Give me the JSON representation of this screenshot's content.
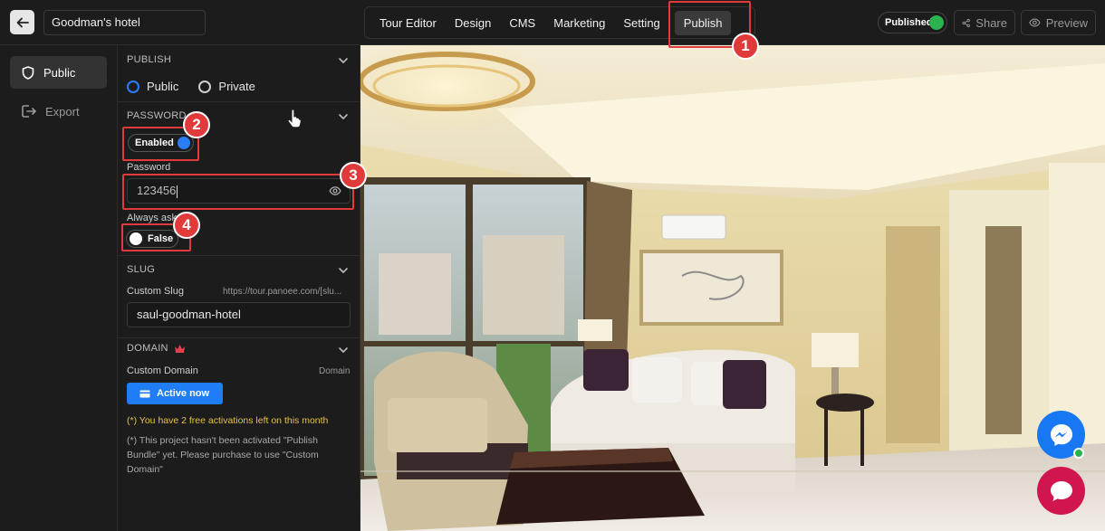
{
  "header": {
    "project_title": "Goodman's hotel",
    "nav": [
      {
        "label": "Tour Editor"
      },
      {
        "label": "Design"
      },
      {
        "label": "CMS"
      },
      {
        "label": "Marketing"
      },
      {
        "label": "Setting"
      },
      {
        "label": "Publish"
      }
    ],
    "active_nav": "Publish",
    "status_label": "Published",
    "status_color": "#2ab34f",
    "share_label": "Share",
    "preview_label": "Preview"
  },
  "rail": {
    "items": [
      {
        "label": "Public",
        "icon": "shield-icon"
      },
      {
        "label": "Export",
        "icon": "export-icon"
      }
    ],
    "active": "Public"
  },
  "panel": {
    "publish": {
      "heading": "PUBLISH",
      "options": [
        "Public",
        "Private"
      ],
      "selected": "Public"
    },
    "password": {
      "heading": "PASSWORD",
      "toggle_label": "Enabled",
      "toggle_on": true,
      "field_label": "Password",
      "field_value": "123456",
      "always_ask_label": "Always ask",
      "always_ask_toggle_label": "False",
      "always_ask_on": false
    },
    "slug": {
      "heading": "SLUG",
      "field_label": "Custom Slug",
      "url_hint": "https://tour.panoee.com/[slu...",
      "value": "saul-goodman-hotel"
    },
    "domain": {
      "heading": "DOMAIN",
      "field_label": "Custom Domain",
      "right_label": "Domain",
      "button_label": "Active now",
      "note_free": "(*) You have 2 free activations left on this month",
      "note_bundle": "(*) This project hasn't been activated \"Publish Bundle\" yet. Please purchase to use \"Custom Domain\""
    }
  },
  "annotations": [
    "1",
    "2",
    "3",
    "4"
  ],
  "colors": {
    "accent_blue": "#2b7df7",
    "annotation_red": "#e03a3a",
    "messenger_blue": "#1877f2",
    "chat_pink": "#d0154f"
  }
}
